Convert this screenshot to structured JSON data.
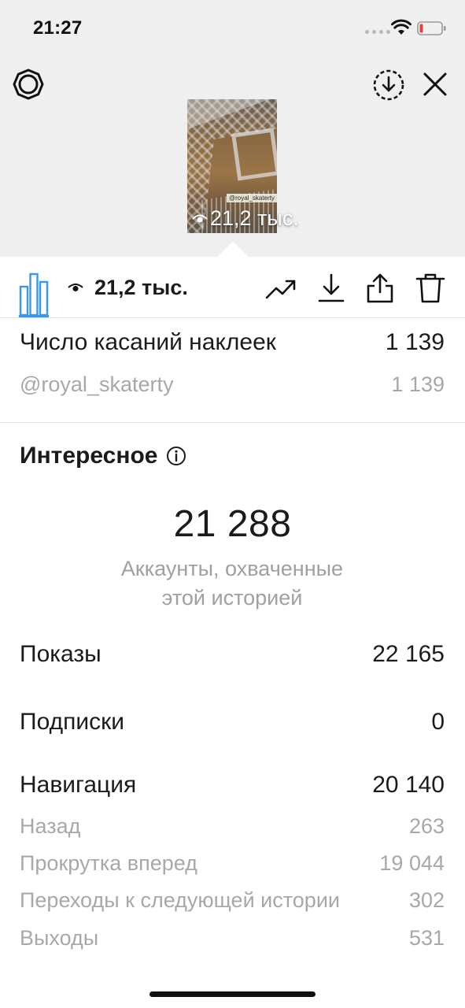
{
  "status_bar": {
    "time": "21:27"
  },
  "story": {
    "tag_text": "@royal_skaterty",
    "views_label": "21,2 тыс."
  },
  "toolbar": {
    "views_count": "21,2 тыс."
  },
  "sticker_taps": {
    "label": "Число касаний наклеек",
    "value": "1 139",
    "items": [
      {
        "label": "@royal_skaterty",
        "value": "1 139"
      }
    ]
  },
  "discovery": {
    "title": "Интересное",
    "reach_value": "21 288",
    "reach_caption_line1": "Аккаунты, охваченные",
    "reach_caption_line2": "этой историей",
    "impressions": {
      "label": "Показы",
      "value": "22 165"
    },
    "follows": {
      "label": "Подписки",
      "value": "0"
    }
  },
  "navigation": {
    "label": "Навигация",
    "value": "20 140",
    "items": [
      {
        "label": "Назад",
        "value": "263"
      },
      {
        "label": "Прокрутка вперед",
        "value": "19 044"
      },
      {
        "label": "Переходы к следующей истории",
        "value": "302"
      },
      {
        "label": "Выходы",
        "value": "531"
      }
    ]
  },
  "colors": {
    "accent": "#3897f0",
    "top_background": "#efefef",
    "secondary_text": "#a8a8a8",
    "battery_low": "#e0433a"
  },
  "icons": {
    "settings": "settings-icon",
    "download_circle": "download-circle-icon",
    "close": "close-icon",
    "insights": "bar-chart-icon",
    "views": "eye-icon",
    "promote": "trending-up-icon",
    "download": "download-icon",
    "share": "share-icon",
    "delete": "trash-icon",
    "info": "info-icon"
  }
}
